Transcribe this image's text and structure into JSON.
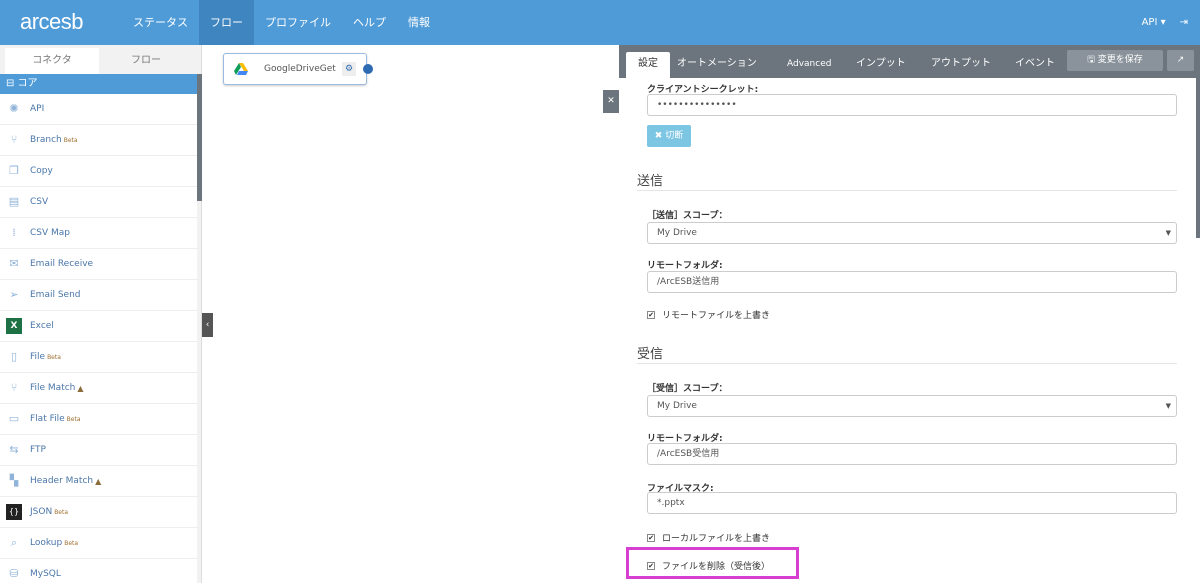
{
  "header": {
    "logo": "arcesb",
    "nav": [
      "ステータス",
      "フロー",
      "プロファイル",
      "ヘルプ",
      "情報"
    ],
    "active_nav": "フロー",
    "user": "API ▾",
    "logout_icon": "sign-out-icon"
  },
  "left": {
    "tabs": [
      "コネクタ",
      "フロー"
    ],
    "section": "⊟ コア",
    "items": [
      {
        "label": "API",
        "icon": "api-icon"
      },
      {
        "label": "Branch",
        "badge": "Beta",
        "icon": "branch-icon"
      },
      {
        "label": "Copy",
        "icon": "copy-icon"
      },
      {
        "label": "CSV",
        "icon": "csv-icon"
      },
      {
        "label": "CSV Map",
        "icon": "csv-map-icon"
      },
      {
        "label": "Email Receive",
        "icon": "email-receive-icon"
      },
      {
        "label": "Email Send",
        "icon": "email-send-icon"
      },
      {
        "label": "Excel",
        "icon": "excel-icon"
      },
      {
        "label": "File",
        "badge": "Beta",
        "icon": "file-icon"
      },
      {
        "label": "File Match",
        "warn": "▲",
        "icon": "file-match-icon"
      },
      {
        "label": "Flat File",
        "badge": "Beta",
        "icon": "flat-file-icon"
      },
      {
        "label": "FTP",
        "icon": "ftp-icon"
      },
      {
        "label": "Header Match",
        "warn": "▲",
        "icon": "header-match-icon"
      },
      {
        "label": "JSON",
        "badge": "Beta",
        "icon": "json-icon"
      },
      {
        "label": "Lookup",
        "badge": "Beta",
        "icon": "lookup-icon"
      },
      {
        "label": "MySQL",
        "icon": "mysql-icon"
      }
    ]
  },
  "canvas": {
    "node": "GoogleDriveGet"
  },
  "panel": {
    "tabs": [
      "設定",
      "オートメーション",
      "Advanced",
      "インプット",
      "アウトプット",
      "イベント"
    ],
    "save": "🖫 変更を保存",
    "external": "↗",
    "client_secret_label": "クライアントシークレット:",
    "client_secret_value": "•••••••••••••••",
    "disconnect": "✖ 切断",
    "send": {
      "title": "送信",
      "scope_label": "［送信］スコープ：",
      "scope_value": "My Drive",
      "folder_label": "リモートフォルダ:",
      "folder_value": "/ArcESB送信用",
      "overwrite": "リモートファイルを上書き",
      "overwrite_checked": true
    },
    "receive": {
      "title": "受信",
      "scope_label": "［受信］スコープ：",
      "scope_value": "My Drive",
      "folder_label": "リモートフォルダ:",
      "folder_value": "/ArcESB受信用",
      "mask_label": "ファイルマスク:",
      "mask_value": "*.pptx",
      "overwrite": "ローカルファイルを上書き",
      "overwrite_checked": true,
      "delete": "ファイルを削除（受信後）",
      "delete_checked": true
    }
  }
}
